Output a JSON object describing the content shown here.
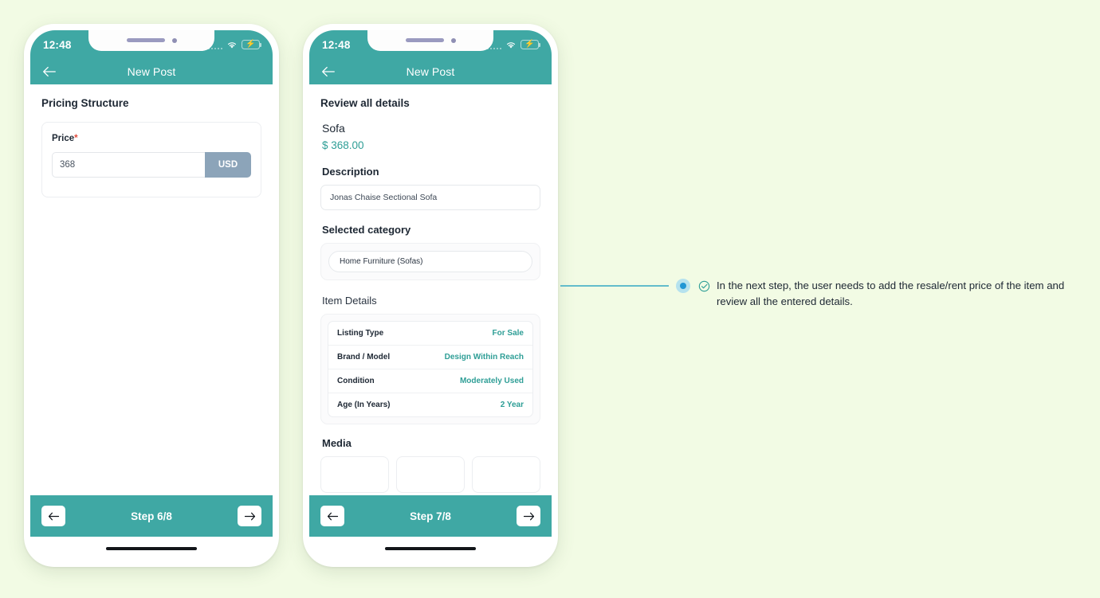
{
  "page": {
    "background_color": "#f2fbe4",
    "accent_teal": "#3fa8a4",
    "value_teal": "#2e9e96",
    "usd_button_color": "#8ca4b9",
    "annotation_blue": "#2196d4"
  },
  "phone1": {
    "status": {
      "time": "12:48",
      "wifi_icon": "wifi-icon",
      "battery_icon": "battery-charging-icon",
      "signal_icon": "signal-dots-icon"
    },
    "appbar": {
      "back_icon": "back-arrow-icon",
      "title": "New Post"
    },
    "section_title": "Pricing Structure",
    "price_field": {
      "label": "Price",
      "required_marker": "*",
      "value": "368",
      "placeholder": "368",
      "currency_label": "USD"
    },
    "bottom": {
      "prev_icon": "arrow-left-icon",
      "step_label": "Step 6/8",
      "next_icon": "arrow-right-icon"
    }
  },
  "phone2": {
    "status": {
      "time": "12:48",
      "wifi_icon": "wifi-icon",
      "battery_icon": "battery-charging-icon",
      "signal_icon": "signal-dots-icon"
    },
    "appbar": {
      "back_icon": "back-arrow-icon",
      "title": "New Post"
    },
    "section_title": "Review all details",
    "item_name": "Sofa",
    "item_price": "$ 368.00",
    "description": {
      "heading": "Description",
      "value": "Jonas Chaise Sectional Sofa"
    },
    "selected_category": {
      "heading": "Selected category",
      "value": "Home Furniture (Sofas)"
    },
    "item_details": {
      "heading": "Item Details",
      "rows": [
        {
          "key": "Listing Type",
          "value": "For Sale"
        },
        {
          "key": "Brand / Model",
          "value": "Design Within Reach"
        },
        {
          "key": "Condition",
          "value": "Moderately Used"
        },
        {
          "key": "Age (In Years)",
          "value": "2 Year"
        }
      ]
    },
    "media": {
      "heading": "Media",
      "thumb_count": 3
    },
    "bottom": {
      "prev_icon": "arrow-left-icon",
      "step_label": "Step 7/8",
      "next_icon": "arrow-right-icon"
    }
  },
  "annotation": {
    "marker_icon": "bullet-dot-icon",
    "check_icon": "check-circle-icon",
    "text": "In the next step, the user needs to add the resale/rent price of the item and review all the entered details."
  }
}
